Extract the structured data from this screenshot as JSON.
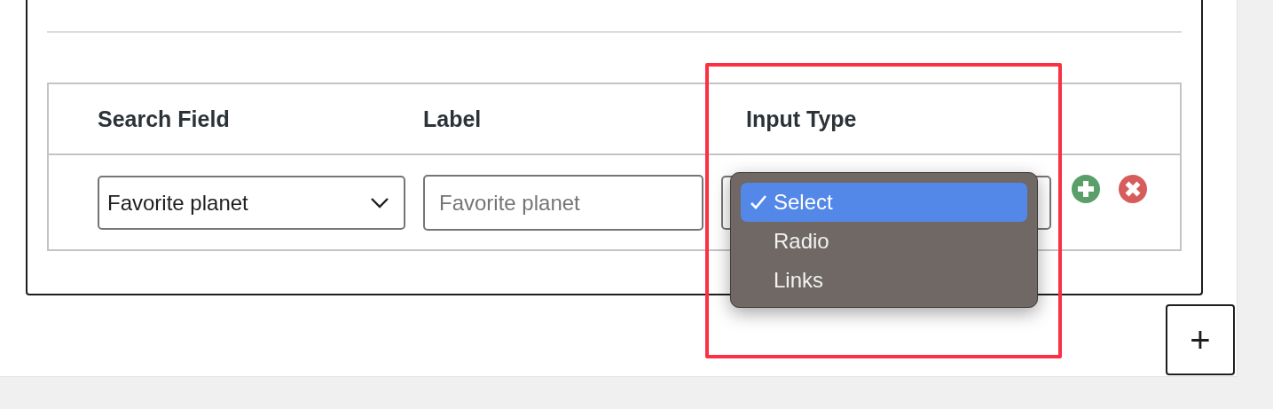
{
  "table": {
    "columns": [
      "Search Field",
      "Label",
      "Input Type"
    ],
    "rows": [
      {
        "search_field": {
          "value": "Favorite planet"
        },
        "label": {
          "placeholder": "Favorite planet"
        },
        "input_type": {
          "expanded": true,
          "options": [
            {
              "label": "Select",
              "selected": true
            },
            {
              "label": "Radio",
              "selected": false
            },
            {
              "label": "Links",
              "selected": false
            }
          ]
        }
      }
    ]
  },
  "highlight": {
    "shown": true
  },
  "add_button": "+"
}
